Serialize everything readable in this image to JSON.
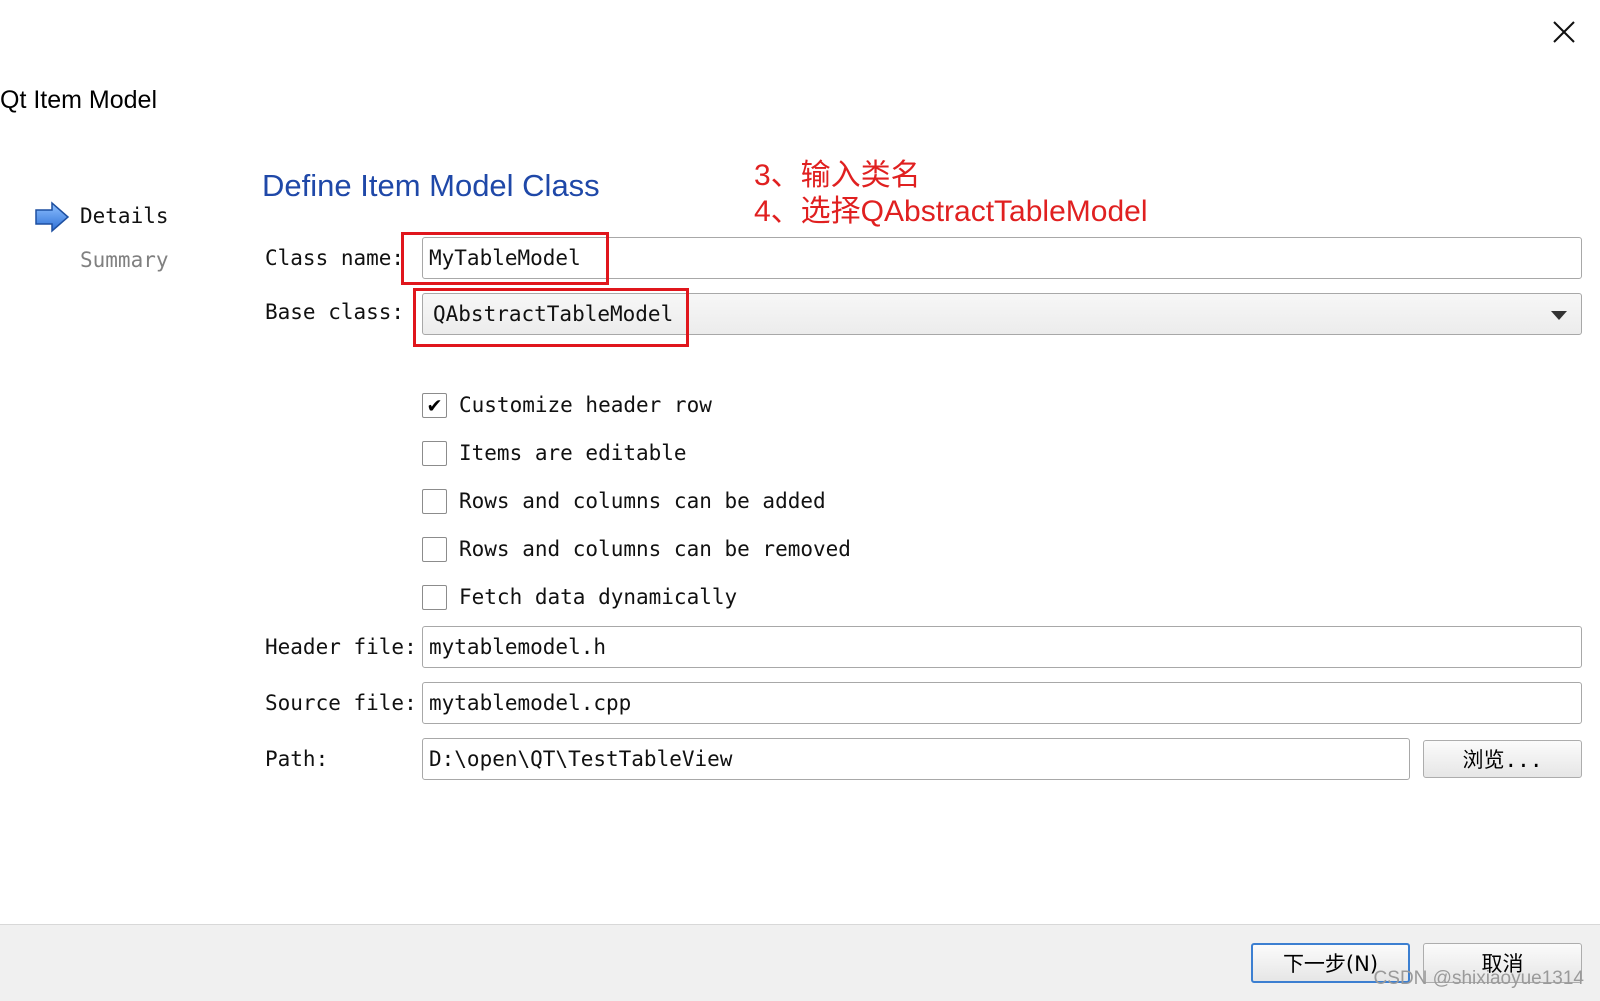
{
  "dialog": {
    "title": "Qt Item Model",
    "close_icon": "close-icon"
  },
  "sidebar": {
    "items": [
      {
        "label": "Details",
        "active": true,
        "icon": "arrow-right-icon"
      },
      {
        "label": "Summary",
        "active": false
      }
    ]
  },
  "page": {
    "heading": "Define Item Model Class"
  },
  "annotation": {
    "line1": "3、输入类名",
    "line2": "4、选择QAbstractTableModel",
    "color": "#e02020"
  },
  "form": {
    "class_name": {
      "label": "Class name:",
      "value": "MyTableModel"
    },
    "base_class": {
      "label": "Base class:",
      "value": "QAbstractTableModel"
    },
    "checkboxes": [
      {
        "label": "Customize header row",
        "checked": true
      },
      {
        "label": "Items are editable",
        "checked": false
      },
      {
        "label": "Rows and columns can be added",
        "checked": false
      },
      {
        "label": "Rows and columns can be removed",
        "checked": false
      },
      {
        "label": "Fetch data dynamically",
        "checked": false
      }
    ],
    "header_file": {
      "label": "Header file:",
      "value": "mytablemodel.h"
    },
    "source_file": {
      "label": "Source file:",
      "value": "mytablemodel.cpp"
    },
    "path": {
      "label": "Path:",
      "value": "D:\\open\\QT\\TestTableView",
      "browse_label": "浏览..."
    }
  },
  "footer": {
    "next_label": "下一步(N)",
    "cancel_label": "取消"
  },
  "watermark": "CSDN @shixiaoyue1314",
  "colors": {
    "heading": "#1f48a8",
    "highlight": "#e0161c",
    "default_button_border": "#3c7fd1"
  }
}
